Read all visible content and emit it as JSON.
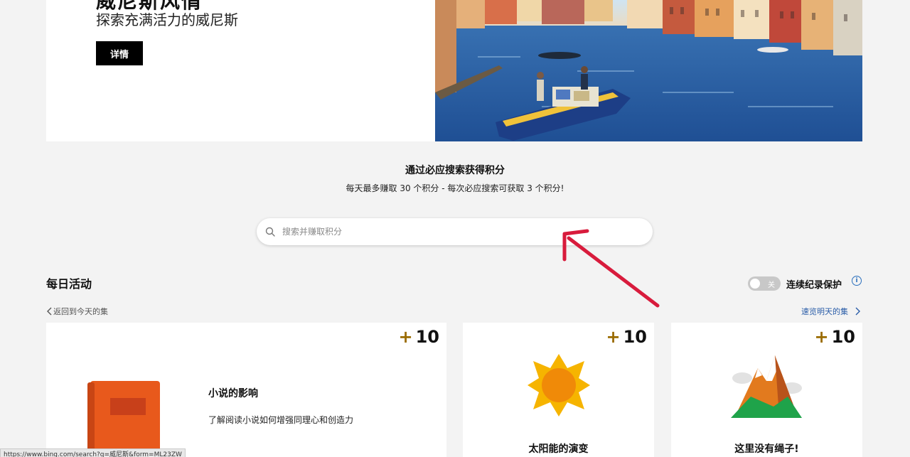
{
  "hero": {
    "subtitle": "探索充满活力的威尼斯",
    "details_button": "详情"
  },
  "points": {
    "heading": "通过必应搜索获得积分",
    "subheading": "每天最多赚取 30 个积分 - 每次必应搜索可获取 3 个积分!"
  },
  "search": {
    "placeholder": "搜索并赚取积分"
  },
  "daily": {
    "title": "每日活动",
    "toggle_state": "关",
    "toggle_label": "连续纪录保护",
    "back_link": "返回到今天的集",
    "next_link": "速览明天的集"
  },
  "cards": [
    {
      "points": "10",
      "title": "小说的影响",
      "description": "了解阅读小说如何增强同理心和创造力",
      "icon": "book-icon"
    },
    {
      "points": "10",
      "title": "太阳能的演变",
      "icon": "sun-icon"
    },
    {
      "points": "10",
      "title": "这里没有绳子!",
      "icon": "mountain-icon"
    }
  ],
  "status_bar": {
    "url": "https://www.bing.com/search?q=威尼斯&form=ML23ZW"
  },
  "colors": {
    "accent_plus": "#9a6b00",
    "link": "#2a5da8",
    "annotation_arrow": "#d81b3c"
  }
}
